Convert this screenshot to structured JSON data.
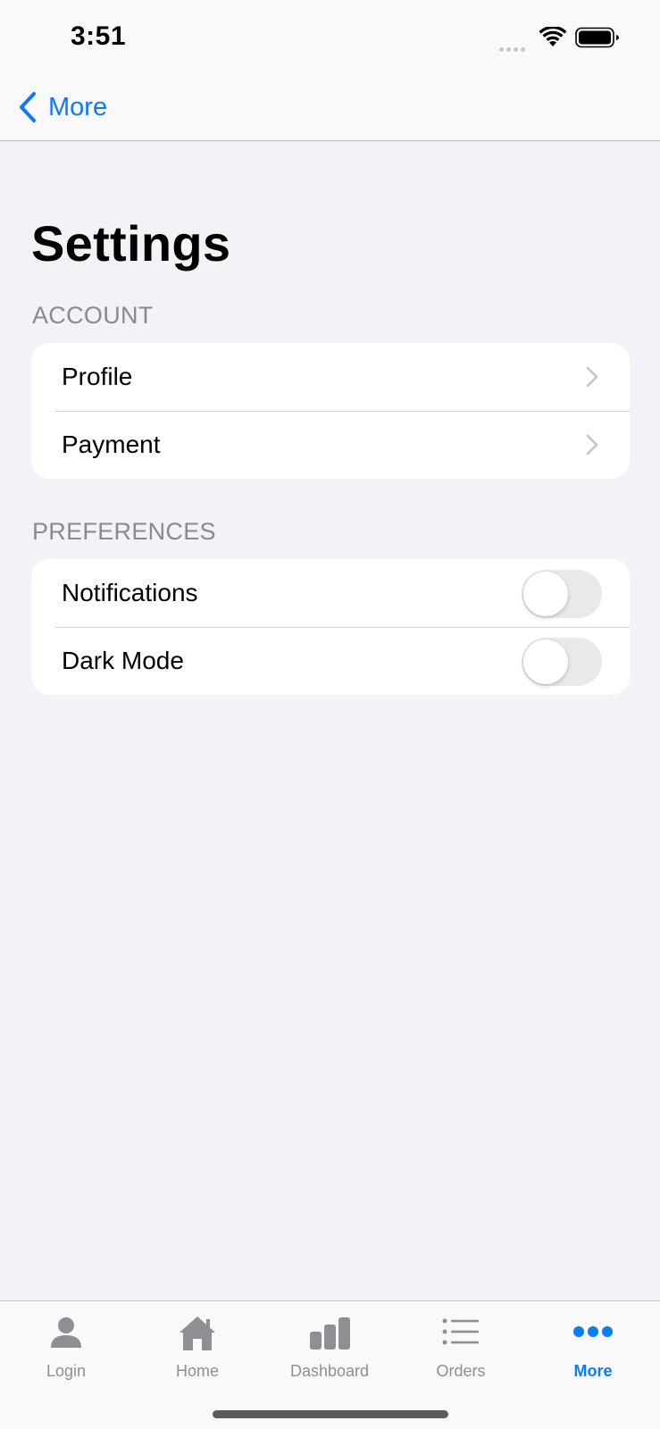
{
  "status_bar": {
    "time": "3:51"
  },
  "nav": {
    "back_label": "More"
  },
  "page": {
    "title": "Settings"
  },
  "sections": [
    {
      "header": "ACCOUNT",
      "rows": [
        {
          "label": "Profile",
          "accessory": "chevron-right-icon"
        },
        {
          "label": "Payment",
          "accessory": "chevron-right-icon"
        }
      ]
    },
    {
      "header": "PREFERENCES",
      "rows": [
        {
          "label": "Notifications",
          "toggle_on": false
        },
        {
          "label": "Dark Mode",
          "toggle_on": false
        }
      ]
    }
  ],
  "tab_bar": {
    "tabs": [
      {
        "label": "Login",
        "icon": "person-icon",
        "active": false
      },
      {
        "label": "Home",
        "icon": "house-icon",
        "active": false
      },
      {
        "label": "Dashboard",
        "icon": "bar-chart-icon",
        "active": false
      },
      {
        "label": "Orders",
        "icon": "list-icon",
        "active": false
      },
      {
        "label": "More",
        "icon": "ellipsis-icon",
        "active": true
      }
    ]
  },
  "colors": {
    "accent": "#0a7aff",
    "background": "#f2f2f7",
    "secondary_text": "#8a8a8e",
    "inactive_tab": "#8e8e93",
    "toggle_off": "#e9e9eb"
  }
}
